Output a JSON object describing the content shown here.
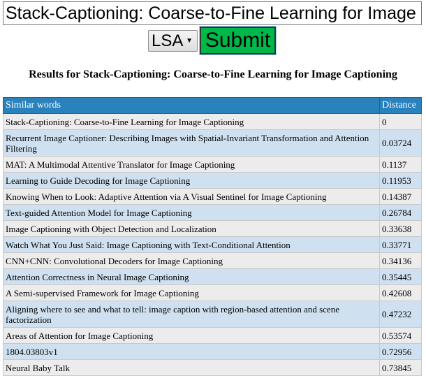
{
  "form": {
    "query_value": "Stack-Captioning: Coarse-to-Fine Learning for Image Captioning",
    "method_selected": "LSA",
    "submit_label": "Submit"
  },
  "heading": "Results for Stack-Captioning: Coarse-to-Fine Learning for Image Captioning",
  "table": {
    "headers": [
      "Similar words",
      "Distance"
    ],
    "rows": [
      {
        "title": "Stack-Captioning: Coarse-to-Fine Learning for Image Captioning",
        "distance": "0"
      },
      {
        "title": "Recurrent Image Captioner: Describing Images with Spatial-Invariant Transformation and Attention Filtering",
        "distance": "0.03724"
      },
      {
        "title": "MAT: A Multimodal Attentive Translator for Image Captioning",
        "distance": "0.1137"
      },
      {
        "title": "Learning to Guide Decoding for Image Captioning",
        "distance": "0.11953"
      },
      {
        "title": "Knowing When to Look: Adaptive Attention via A Visual Sentinel for Image Captioning",
        "distance": "0.14387"
      },
      {
        "title": "Text-guided Attention Model for Image Captioning",
        "distance": "0.26784"
      },
      {
        "title": "Image Captioning with Object Detection and Localization",
        "distance": "0.33638"
      },
      {
        "title": "Watch What You Just Said: Image Captioning with Text-Conditional Attention",
        "distance": "0.33771"
      },
      {
        "title": "CNN+CNN: Convolutional Decoders for Image Captioning",
        "distance": "0.34136"
      },
      {
        "title": "Attention Correctness in Neural Image Captioning",
        "distance": "0.35445"
      },
      {
        "title": "A Semi-supervised Framework for Image Captioning",
        "distance": "0.42608"
      },
      {
        "title": "Aligning where to see and what to tell: image caption with region-based attention and scene factorization",
        "distance": "0.47232"
      },
      {
        "title": "Areas of Attention for Image Captioning",
        "distance": "0.53574"
      },
      {
        "title": "1804.03803v1",
        "distance": "0.72956"
      },
      {
        "title": "Neural Baby Talk",
        "distance": "0.73845"
      }
    ]
  }
}
